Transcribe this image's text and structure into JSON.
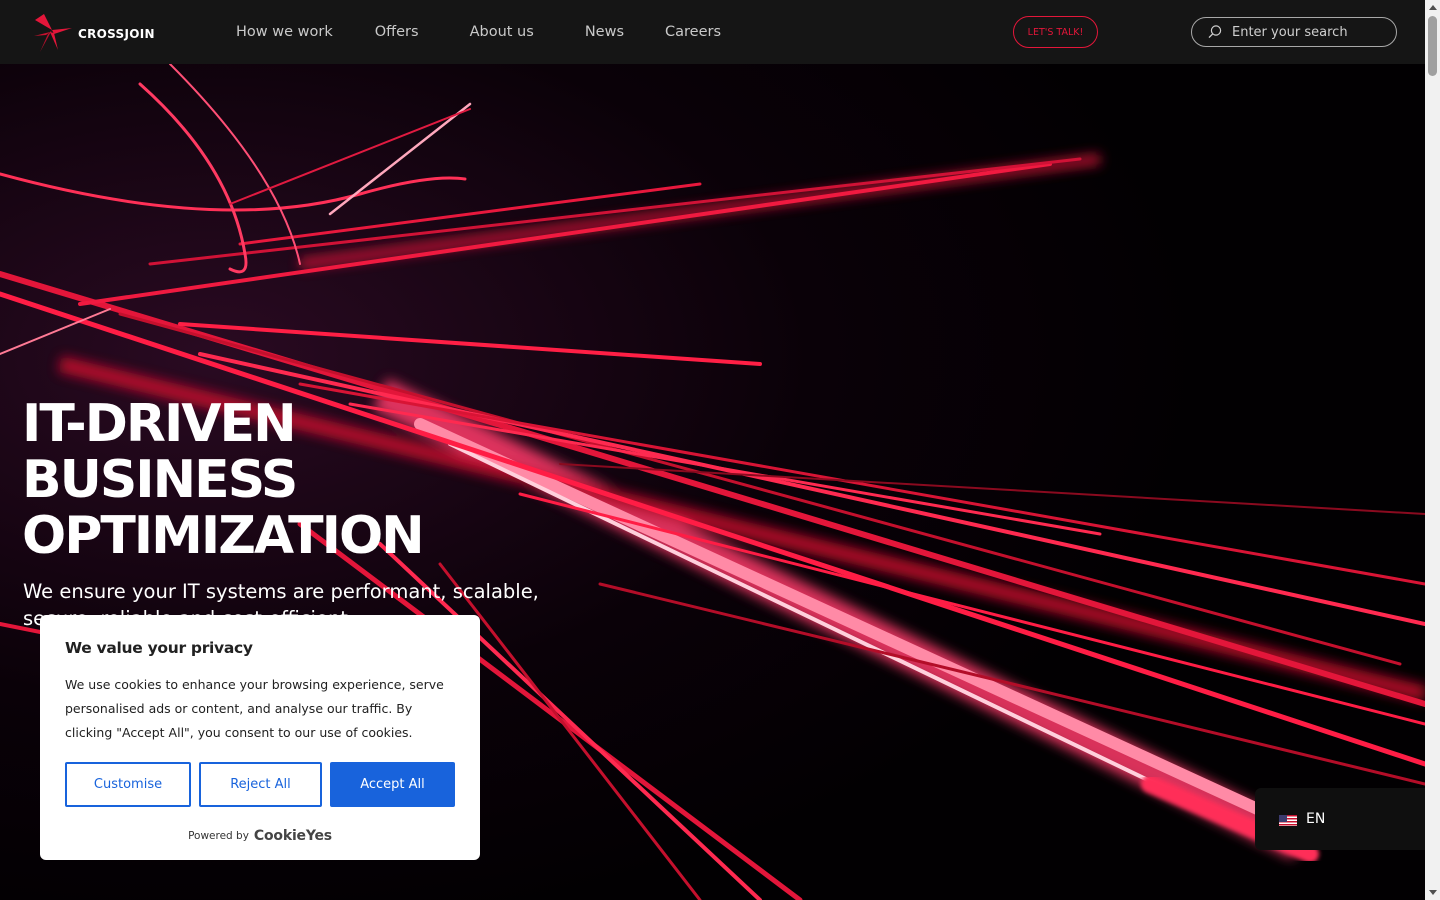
{
  "brand": {
    "name": "CROSSJOIN"
  },
  "nav": {
    "items": [
      {
        "label": "How we work"
      },
      {
        "label": "Offers"
      },
      {
        "label": "About us"
      },
      {
        "label": "News"
      },
      {
        "label": "Careers"
      }
    ]
  },
  "header": {
    "cta_label": "LET'S TALK!",
    "search_placeholder": "Enter your search"
  },
  "hero": {
    "title_lines": [
      "IT-DRIVEN",
      "BUSINESS",
      "OPTIMIZATION"
    ],
    "subtitle": "We ensure your IT systems are performant, scalable, secure, reliable and cost-efficient."
  },
  "cookie": {
    "title": "We value your privacy",
    "text": "We use cookies to enhance your browsing experience, serve personalised ads or content, and analyse our traffic. By clicking \"Accept All\", you consent to our use of cookies.",
    "customise_label": "Customise",
    "reject_label": "Reject All",
    "accept_label": "Accept All",
    "powered_by_label": "Powered by",
    "powered_by_brand": "CookieYes"
  },
  "language": {
    "code": "EN",
    "flag_icon": "us-flag-icon"
  },
  "colors": {
    "accent": "#e4163a",
    "header_bg": "#151515",
    "cookie_primary": "#1863dc"
  }
}
